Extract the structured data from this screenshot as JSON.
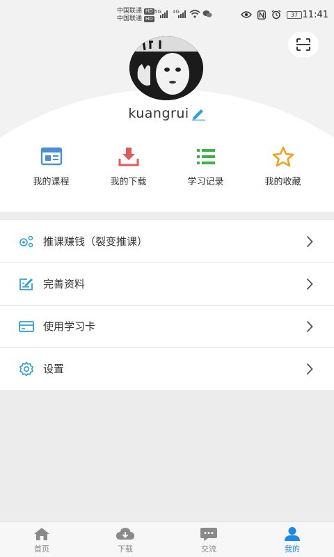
{
  "status_bar": {
    "carrier1": "中国联通",
    "carrier2": "中国联通",
    "hd": "HD",
    "net1": "5G",
    "net2": "4G",
    "battery": "37",
    "time": "11:41"
  },
  "profile": {
    "username": "kuangrui"
  },
  "shortcuts": [
    {
      "label": "我的课程",
      "icon": "course-icon",
      "color": "#4a8fd4"
    },
    {
      "label": "我的下载",
      "icon": "download-icon",
      "color": "#e25a5a"
    },
    {
      "label": "学习记录",
      "icon": "record-icon",
      "color": "#3db346"
    },
    {
      "label": "我的收藏",
      "icon": "star-icon",
      "color": "#f0a020"
    }
  ],
  "menu": [
    {
      "label": "推课赚钱（裂变推课）",
      "icon": "share-icon"
    },
    {
      "label": "完善资料",
      "icon": "edit-profile-icon"
    },
    {
      "label": "使用学习卡",
      "icon": "card-icon"
    },
    {
      "label": "设置",
      "icon": "settings-icon"
    }
  ],
  "tabs": [
    {
      "label": "首页",
      "icon": "home-icon"
    },
    {
      "label": "下载",
      "icon": "cloud-download-icon"
    },
    {
      "label": "交流",
      "icon": "chat-icon"
    },
    {
      "label": "我的",
      "icon": "user-icon",
      "active": true
    }
  ],
  "colors": {
    "accent": "#1e88e5",
    "menu_icon": "#2b9fd8"
  }
}
